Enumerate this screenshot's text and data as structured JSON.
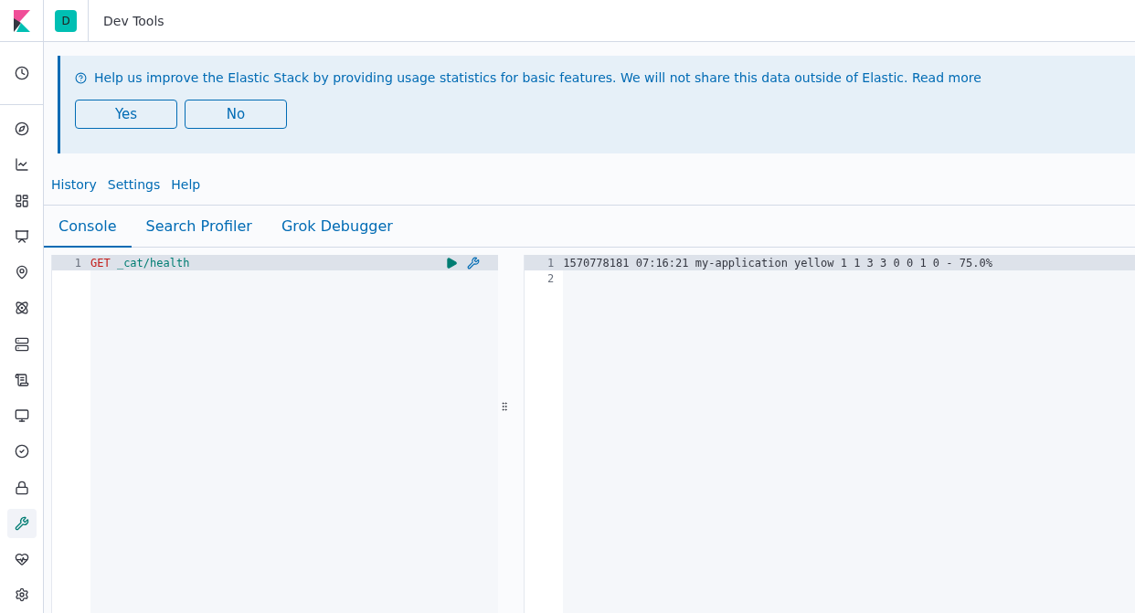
{
  "header": {
    "space_avatar": "D",
    "title": "Dev Tools"
  },
  "sidebar": {
    "items": [
      {
        "kind": "recent",
        "selected": false
      },
      {
        "kind": "discover",
        "selected": false
      },
      {
        "kind": "visualize",
        "selected": false
      },
      {
        "kind": "dashboard",
        "selected": false
      },
      {
        "kind": "canvas",
        "selected": false
      },
      {
        "kind": "maps",
        "selected": false
      },
      {
        "kind": "ml",
        "selected": false
      },
      {
        "kind": "infrastructure",
        "selected": false
      },
      {
        "kind": "logs",
        "selected": false
      },
      {
        "kind": "apm",
        "selected": false
      },
      {
        "kind": "uptime",
        "selected": false
      },
      {
        "kind": "siem",
        "selected": false
      },
      {
        "kind": "devtools",
        "selected": true
      },
      {
        "kind": "monitoring",
        "selected": false
      },
      {
        "kind": "management",
        "selected": false
      }
    ]
  },
  "banner": {
    "message": "Help us improve the Elastic Stack by providing usage statistics for basic features. We will not share this data outside of Elastic.",
    "link": "Read more",
    "buttons": [
      "Yes",
      "No"
    ]
  },
  "top_links": [
    "History",
    "Settings",
    "Help"
  ],
  "tabs": [
    {
      "label": "Console",
      "selected": true
    },
    {
      "label": "Search Profiler",
      "selected": false
    },
    {
      "label": "Grok Debugger",
      "selected": false
    }
  ],
  "request": {
    "lines": [
      {
        "number": "1",
        "method": "GET",
        "path": "_cat/health"
      }
    ]
  },
  "response": {
    "lines": [
      {
        "number": "1",
        "text": "1570778181 07:16:21 my-application yellow 1 1 3 3 0 0 1 0 - 75.0%"
      },
      {
        "number": "2"
      }
    ]
  }
}
